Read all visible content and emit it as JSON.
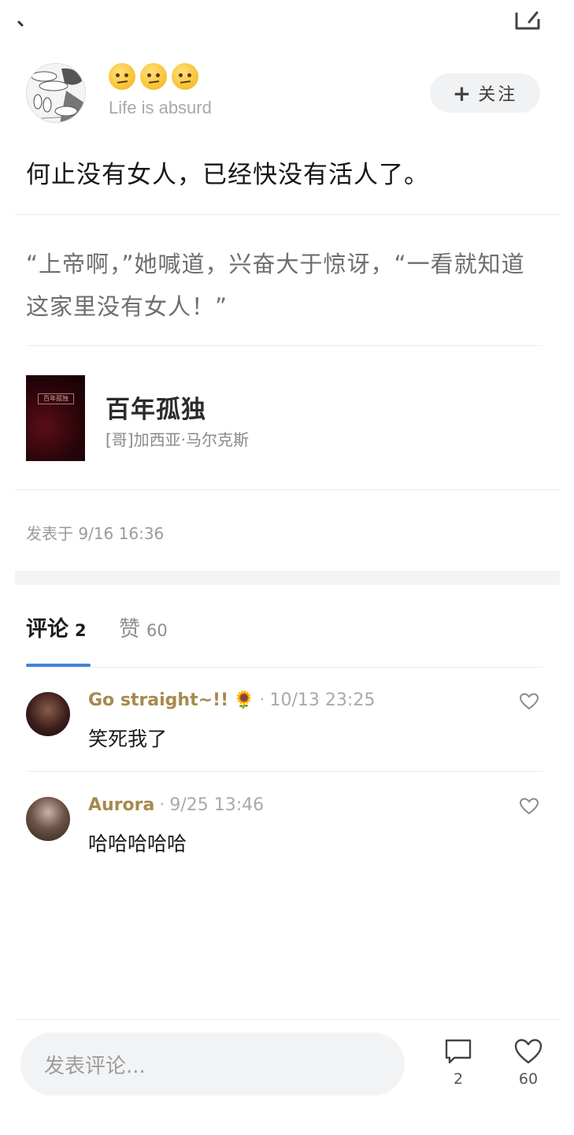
{
  "header": {
    "back_icon": "chevron-left-icon",
    "share_icon": "share-box-icon"
  },
  "author": {
    "avatar_icon": "comic-avatar",
    "emojis": [
      "🤨",
      "🤨",
      "🤨"
    ],
    "subtitle": "Life is absurd",
    "follow_label": "关注",
    "follow_icon": "plus-icon"
  },
  "post": {
    "title": "何止没有女人，已经快没有活人了。",
    "quote_line1": "“上帝啊，”她喊道，兴奋大于惊讶，“一看就知道",
    "quote_line2": "这家里没有女人！”",
    "book": {
      "title": "百年孤独",
      "author": "[哥]加西亚·马尔克斯",
      "cover_text": "百年孤独"
    },
    "time": "发表于 9/16 16:36"
  },
  "tabs": [
    {
      "label": "评论",
      "count": "2",
      "active": true
    },
    {
      "label": "赞",
      "count": "60",
      "active": false
    }
  ],
  "comments": [
    {
      "name": "Go straight~!!",
      "emoji": "🌻",
      "separator": "·",
      "time": "10/13 23:25",
      "text": "笑死我了"
    },
    {
      "name": "Aurora",
      "separator": "·",
      "time": "9/25 13:46",
      "text": "哈哈哈哈哈"
    }
  ],
  "bottom": {
    "input_placeholder": "发表评论...",
    "comment_count": "2",
    "like_count": "60"
  },
  "colors": {
    "accent": "#3e84d8",
    "username": "#a58a4e",
    "muted": "#a9a9a9"
  }
}
